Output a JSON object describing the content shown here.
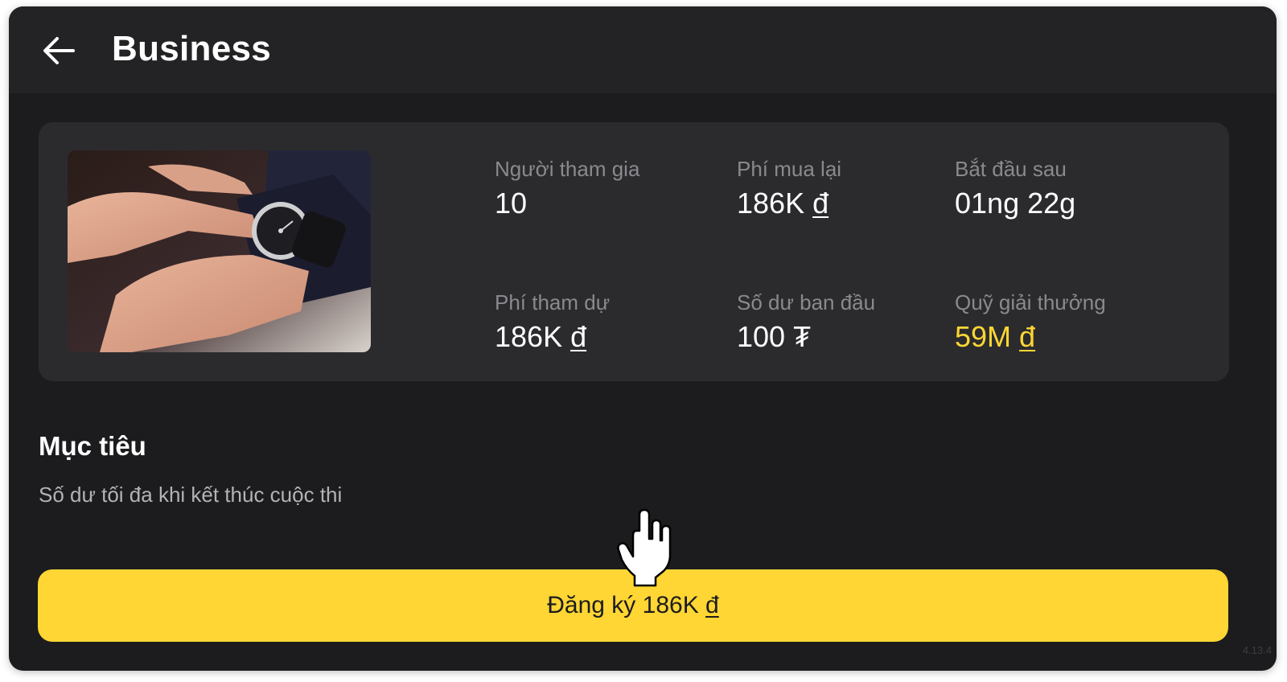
{
  "header": {
    "title": "Business",
    "back_icon": "arrow-left-icon"
  },
  "card": {
    "image_alt": "wristwatch",
    "stats": {
      "participants": {
        "label": "Người tham gia",
        "value": "10"
      },
      "rebuy_fee": {
        "label": "Phí mua lại",
        "value": "186K",
        "currency": "đ"
      },
      "starts_in": {
        "label": "Bắt đầu sau",
        "value": "01ng 22g"
      },
      "entry_fee": {
        "label": "Phí tham dự",
        "value": "186K",
        "currency": "đ"
      },
      "initial_balance": {
        "label": "Số dư ban đầu",
        "value": "100",
        "currency": "₮"
      },
      "prize_pool": {
        "label": "Quỹ giải thưởng",
        "value": "59M",
        "currency": "đ"
      }
    }
  },
  "goal": {
    "title": "Mục tiêu",
    "description": "Số dư tối đa khi kết thúc cuộc thi"
  },
  "register_button": {
    "label": "Đăng ký 186K",
    "currency": "đ"
  },
  "version": "4.13.4",
  "colors": {
    "background": "#1c1c1e",
    "topbar": "#232325",
    "card": "#2b2b2e",
    "accent": "#ffd633",
    "label_gray": "#8a8a8e"
  }
}
